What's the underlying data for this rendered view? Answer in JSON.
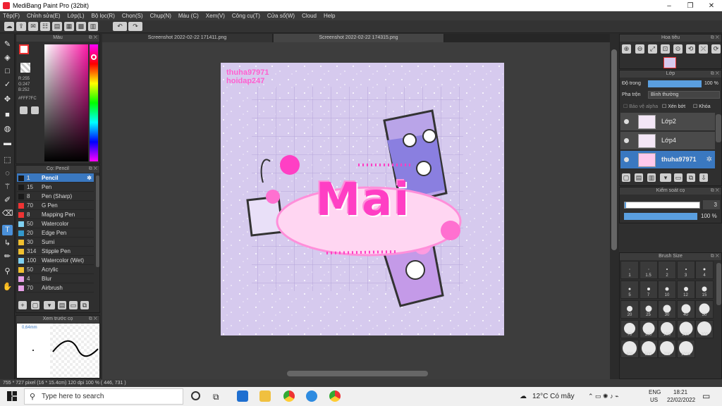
{
  "window": {
    "title": "MediBang Paint Pro (32bit)"
  },
  "menu": [
    "Tệp(F)",
    "Chỉnh sửa(E)",
    "Lớp(L)",
    "Bộ lọc(R)",
    "Chọn(S)",
    "Chụp(N)",
    "Màu (C)",
    "Xem(V)",
    "Công cụ(T)",
    "Cửa sổ(W)",
    "Cloud",
    "Help"
  ],
  "color_panel": {
    "title": "Màu",
    "r": "R:255",
    "g": "G:247",
    "b": "B:252",
    "hex": "#FFF7FC"
  },
  "brush_panel": {
    "title": "Cọ: Pencil",
    "items": [
      {
        "num": "1",
        "name": "Pencil",
        "color": "#1a1a1a"
      },
      {
        "num": "15",
        "name": "Pen",
        "color": "#1a1a1a"
      },
      {
        "num": "8",
        "name": "Pen (Sharp)",
        "color": "#1a1a1a"
      },
      {
        "num": "70",
        "name": "G Pen",
        "color": "#e33"
      },
      {
        "num": "8",
        "name": "Mapping Pen",
        "color": "#e33"
      },
      {
        "num": "50",
        "name": "Watercolor",
        "color": "#7fd0f0"
      },
      {
        "num": "20",
        "name": "Edge Pen",
        "color": "#39c"
      },
      {
        "num": "30",
        "name": "Sumi",
        "color": "#f0c030"
      },
      {
        "num": "314",
        "name": "Stipple Pen",
        "color": "#f0c030"
      },
      {
        "num": "100",
        "name": "Watercolor (Wet)",
        "color": "#7fd0f0"
      },
      {
        "num": "50",
        "name": "Acrylic",
        "color": "#f0c030"
      },
      {
        "num": "4",
        "name": "Blur",
        "color": "#e8a0e8"
      },
      {
        "num": "70",
        "name": "Airbrush",
        "color": "#e8a0e8"
      }
    ]
  },
  "preview_panel": {
    "title": "Xem trước cọ",
    "size": "0,64mm"
  },
  "tabs": [
    "Screenshot 2022-02-22 171411.png",
    "Screenshot 2022-02-22 174315.png"
  ],
  "canvas": {
    "watermark1": "thuha97971",
    "watermark2": "hoidap247",
    "art_text": "Mai"
  },
  "navigator": {
    "title": "Hoa tiêu"
  },
  "layer_panel": {
    "title": "Lớp",
    "opacity_label": "Độ trong",
    "opacity_value": "100 %",
    "blend_label": "Pha trộn",
    "blend_value": "Bình thường",
    "protect_alpha": "Bảo vệ alpha",
    "clip": "Xén bớt",
    "lock": "Khóa",
    "layers": [
      "Lớp2",
      "Lớp4",
      "thuha97971"
    ]
  },
  "brush_control": {
    "title": "Kiểm soát cọ",
    "size": "3",
    "opacity": "100 %",
    "size_fill": 0.98,
    "opacity_fill": 0.98
  },
  "brush_size": {
    "title": "Brush Size",
    "sizes": [
      "1",
      "1.5",
      "2",
      "3",
      "4",
      "5",
      "7",
      "10",
      "12",
      "15",
      "20",
      "25",
      "30",
      "40",
      "50",
      "70",
      "100",
      "150",
      "200",
      "300",
      "400",
      "500",
      "700",
      "1000"
    ]
  },
  "status": {
    "text": "755 * 727 pixel   (16 * 15.4cm)   120 dpi   100 %   ( 446, 731 )"
  },
  "taskbar": {
    "search_placeholder": "Type here to search",
    "weather": "12°C  Có mây",
    "lang1": "ENG",
    "lang2": "US",
    "time": "18:21",
    "date": "22/02/2022"
  },
  "colors": {
    "accent": "#3a78c0",
    "canvas_bg": "#d9cdf0",
    "pink": "#ff5fc8"
  }
}
